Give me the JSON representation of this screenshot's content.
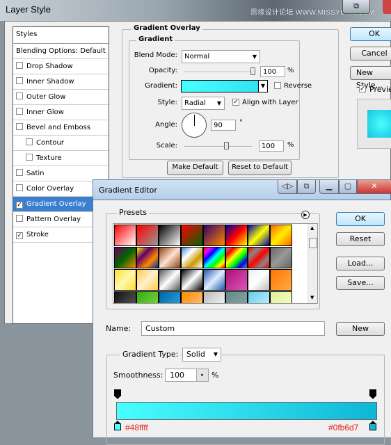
{
  "layer_style": {
    "title": "Layer Style",
    "watermark": "思缘设计论坛 WWW.MISSYUAN.COM",
    "styles_header": "Styles",
    "items": [
      {
        "label": "Blending Options: Default",
        "checkbox": false,
        "checked": false
      },
      {
        "label": "Drop Shadow",
        "checkbox": true,
        "checked": false
      },
      {
        "label": "Inner Shadow",
        "checkbox": true,
        "checked": false
      },
      {
        "label": "Outer Glow",
        "checkbox": true,
        "checked": false
      },
      {
        "label": "Inner Glow",
        "checkbox": true,
        "checked": false
      },
      {
        "label": "Bevel and Emboss",
        "checkbox": true,
        "checked": false
      },
      {
        "label": "Contour",
        "checkbox": true,
        "checked": false,
        "indent": true
      },
      {
        "label": "Texture",
        "checkbox": true,
        "checked": false,
        "indent": true
      },
      {
        "label": "Satin",
        "checkbox": true,
        "checked": false
      },
      {
        "label": "Color Overlay",
        "checkbox": true,
        "checked": false
      },
      {
        "label": "Gradient Overlay",
        "checkbox": true,
        "checked": true,
        "selected": true
      },
      {
        "label": "Pattern Overlay",
        "checkbox": true,
        "checked": false
      },
      {
        "label": "Stroke",
        "checkbox": true,
        "checked": true
      }
    ],
    "section_title": "Gradient Overlay",
    "subsection_title": "Gradient",
    "blend_mode_label": "Blend Mode:",
    "blend_mode": "Normal",
    "opacity_label": "Opacity:",
    "opacity": "100",
    "opacity_unit": "%",
    "opacity_percent": 100,
    "gradient_label": "Gradient:",
    "reverse_label": "Reverse",
    "reverse_checked": false,
    "style_label": "Style:",
    "style": "Radial",
    "align_label": "Align with Layer",
    "align_checked": true,
    "angle_label": "Angle:",
    "angle": "90",
    "angle_unit": "°",
    "scale_label": "Scale:",
    "scale": "100",
    "scale_unit": "%",
    "scale_percent": 100,
    "make_default": "Make Default",
    "reset_default": "Reset to Default",
    "ok": "OK",
    "cancel": "Cancel",
    "new_style": "New Style...",
    "preview_label": "Preview",
    "preview_checked": true
  },
  "gradient_editor": {
    "title": "Gradient Editor",
    "presets_label": "Presets",
    "ok": "OK",
    "reset": "Reset",
    "load": "Load...",
    "save": "Save...",
    "name_label": "Name:",
    "name_value": "Custom",
    "new": "New",
    "gradient_type_label": "Gradient Type:",
    "gradient_type": "Solid",
    "smoothness_label": "Smoothness:",
    "smoothness": "100",
    "smoothness_unit": "%",
    "stop_left_color": "#48ffff",
    "stop_right_color": "#0fb6d7",
    "presets": [
      [
        "#ff0000",
        "#ffffff"
      ],
      [
        "#ff0000",
        "#999999"
      ],
      [
        "#000000",
        "#ffffff"
      ],
      [
        "#ff0000",
        "#006600"
      ],
      [
        "#330066",
        "#ff8800"
      ],
      [
        "#0000aa",
        "#ff0000",
        "#ffff00"
      ],
      [
        "#0000aa",
        "#ffff00",
        "#0000aa"
      ],
      [
        "#ff6600",
        "#ffee00",
        "#ff6600"
      ],
      [
        "#660066",
        "#006600",
        "#ff8800"
      ],
      [
        "#ffee00",
        "#660066",
        "#ff8800",
        "#003399"
      ],
      [
        "#8b4513",
        "#ffe0d0",
        "#8b4513"
      ],
      [
        "#3388dd",
        "#ffffff",
        "#cc9900",
        "#ffffff"
      ],
      [
        "#ff0000",
        "#ff00ff",
        "#0000ff",
        "#00ffff",
        "#00ff00",
        "#ffff00",
        "#ff0000"
      ],
      [
        "#888888",
        "#ff0000",
        "#ffff00",
        "#00ff00",
        "#0000ff",
        "#888888"
      ],
      [
        "#ff0000",
        "#888888",
        "#ff0000",
        "#888888",
        "#ff0000"
      ],
      [
        "#666666",
        "#999999",
        "#666666"
      ],
      [
        "#ffdd33",
        "#fff8aa",
        "#ffdd33"
      ],
      [
        "#ffcc44",
        "#fff0cc",
        "#ffcc44"
      ],
      [
        "#555555",
        "#ffffff",
        "#555555"
      ],
      [
        "#000000",
        "#ffffff",
        "#000000"
      ],
      [
        "#2255aa",
        "#ddeeff",
        "#2255aa"
      ],
      [
        "#aa1177",
        "#dd55bb"
      ],
      [
        "#eeeeee",
        "#ffffff",
        "#bbbbbb"
      ],
      [
        "#ff7700",
        "#ffaa44"
      ],
      [
        "#111111",
        "#666666"
      ],
      [
        "#33aa11",
        "#88dd44"
      ],
      [
        "#0066aa",
        "#33aadd"
      ],
      [
        "#ff8800",
        "#ffcc88"
      ],
      [
        "#bbbbbb",
        "#ffffff"
      ],
      [
        "#668888",
        "#88aaaa"
      ],
      [
        "#66ccee",
        "#ccf4ff"
      ],
      [
        "#ddee99",
        "#ffffcc"
      ]
    ]
  }
}
